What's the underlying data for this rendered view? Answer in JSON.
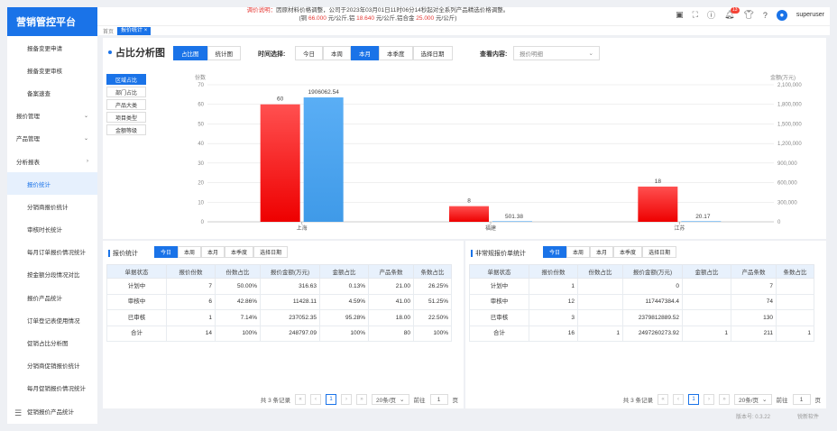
{
  "app": {
    "title": "营销管控平台"
  },
  "sidebar": {
    "items": [
      {
        "label": "报备变更申请",
        "sub": true
      },
      {
        "label": "报备变更审核",
        "sub": true
      },
      {
        "label": "备案速查",
        "sub": true
      },
      {
        "label": "报价管理",
        "arrow": "⌄"
      },
      {
        "label": "产品管理",
        "arrow": "⌄"
      },
      {
        "label": "分析报表",
        "arrow": "›"
      },
      {
        "label": "报价统计",
        "sub": true,
        "active": true
      },
      {
        "label": "分销商报价统计",
        "sub": true
      },
      {
        "label": "审核时长统计",
        "sub": true
      },
      {
        "label": "每月订单报价情况统计",
        "sub": true
      },
      {
        "label": "按金额分段情况对比",
        "sub": true
      },
      {
        "label": "报价产品统计",
        "sub": true
      },
      {
        "label": "订单登记表使用情况",
        "sub": true
      },
      {
        "label": "促销占比分析图",
        "sub": true
      },
      {
        "label": "分销商促销报价统计",
        "sub": true
      },
      {
        "label": "每月促销报价情况统计",
        "sub": true
      },
      {
        "label": "促销报价产品统计",
        "sub": true
      }
    ]
  },
  "notice": {
    "prefix": "调价说明：",
    "line1": "因原材料价格调整，公司于2023年03月01日11时06分14秒起对全系列产品精选价格调整。",
    "line2a": "(铜",
    "v1": "66.000",
    "line2b": "元/公斤,铝",
    "v2": "18.640",
    "line2c": "元/公斤,铝合金",
    "v3": "25.000",
    "line2d": "元/公斤)"
  },
  "header": {
    "badge": "13",
    "user": "superuser"
  },
  "tabs": {
    "home": "首页",
    "current": "报价统计",
    "close": "×"
  },
  "page": {
    "title": "占比分析图"
  },
  "view_tabs": [
    "占比图",
    "统计图"
  ],
  "time_label": "时间选择:",
  "time_tabs": [
    "今日",
    "本周",
    "本月",
    "本季度",
    "选择日期"
  ],
  "time_active": 2,
  "content_label": "查看内容:",
  "content_select": "报价明细",
  "dim_tabs": [
    "区域占比",
    "部门占比",
    "产品大类",
    "项目类型",
    "金额等级"
  ],
  "chart_data": {
    "type": "bar",
    "categories": [
      "上海",
      "福建",
      "江苏"
    ],
    "series": [
      {
        "name": "份数",
        "axis": "left",
        "values": [
          60,
          8,
          18
        ],
        "labels": [
          "60",
          "8",
          "18"
        ],
        "color": "#ff2020"
      },
      {
        "name": "金额(万元)",
        "axis": "right",
        "values": [
          1906062.54,
          501.38,
          20.17
        ],
        "labels": [
          "1906062.54",
          "501.38",
          "20.17"
        ],
        "color": "#4aa3f0"
      }
    ],
    "ylabel_left": "份数",
    "ylabel_right": "金额(万元)",
    "ylim_left": [
      0,
      70
    ],
    "ylim_right": [
      0,
      2100000
    ],
    "yticks_left": [
      "0",
      "10",
      "20",
      "30",
      "40",
      "50",
      "60",
      "70"
    ],
    "yticks_right": [
      "0",
      "300,000",
      "600,000",
      "900,000",
      "1,200,000",
      "1,500,000",
      "1,800,000",
      "2,100,000"
    ],
    "grid": true
  },
  "left_table": {
    "title": "报价统计",
    "tabs": [
      "今日",
      "本周",
      "本月",
      "本季度",
      "选择日期"
    ],
    "headers": [
      "单据状态",
      "报价份数",
      "份数占比",
      "报价金额(万元)",
      "金额占比",
      "产品条数",
      "条数占比"
    ],
    "rows": [
      [
        "计划中",
        "7",
        "50.00%",
        "316.63",
        "0.13%",
        "21.00",
        "26.25%"
      ],
      [
        "审核中",
        "6",
        "42.86%",
        "11428.11",
        "4.59%",
        "41.00",
        "51.25%"
      ],
      [
        "已审核",
        "1",
        "7.14%",
        "237052.35",
        "95.28%",
        "18.00",
        "22.50%"
      ],
      [
        "合计",
        "14",
        "100%",
        "248797.09",
        "100%",
        "80",
        "100%"
      ]
    ],
    "pager": {
      "total": "共 3 条记录",
      "page": "1",
      "size": "20条/页",
      "goto": "前往",
      "goto_val": "1",
      "unit": "页"
    }
  },
  "right_table": {
    "title": "非常规报价单统计",
    "tabs": [
      "今日",
      "本周",
      "本月",
      "本季度",
      "选择日期"
    ],
    "headers": [
      "单据状态",
      "报价份数",
      "份数占比",
      "报价金额(万元)",
      "金额占比",
      "产品条数",
      "条数占比"
    ],
    "rows": [
      [
        "计划中",
        "1",
        "",
        "0",
        "",
        "7",
        ""
      ],
      [
        "审核中",
        "12",
        "",
        "117447384.4",
        "",
        "74",
        ""
      ],
      [
        "已审核",
        "3",
        "",
        "2379812889.52",
        "",
        "130",
        ""
      ],
      [
        "合计",
        "16",
        "1",
        "2497260273.92",
        "1",
        "211",
        "1"
      ]
    ],
    "pager": {
      "total": "共 3 条记录",
      "page": "1",
      "size": "20条/页",
      "goto": "前往",
      "goto_val": "1",
      "unit": "页"
    }
  },
  "footer": {
    "version": "版本号: 0.3.22",
    "company": "锐新软件"
  }
}
